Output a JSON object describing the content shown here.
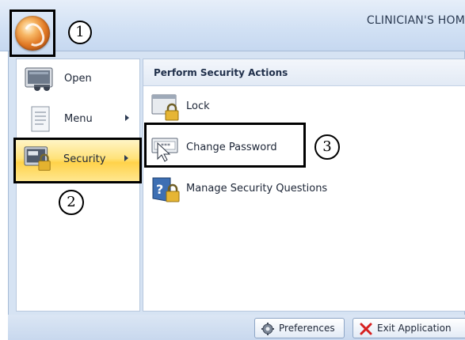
{
  "window": {
    "title": "CLINICIAN'S HOM"
  },
  "app_button": {
    "icon": "app-orb-icon"
  },
  "callouts": [
    "1",
    "2",
    "3"
  ],
  "left_menu": {
    "items": [
      {
        "label": "Open",
        "icon": "open-folder-icon",
        "has_submenu": false
      },
      {
        "label": "Menu",
        "icon": "document-icon",
        "has_submenu": true
      },
      {
        "label": "Security",
        "icon": "security-lock-icon",
        "has_submenu": true,
        "selected": true
      }
    ]
  },
  "right_panel": {
    "header": "Perform Security Actions",
    "actions": [
      {
        "label": "Lock",
        "icon": "lock-icon"
      },
      {
        "label": "Change Password",
        "icon": "change-password-icon"
      },
      {
        "label": "Manage Security Questions",
        "icon": "security-questions-icon"
      }
    ]
  },
  "footer": {
    "preferences_label": "Preferences",
    "exit_label": "Exit Application"
  },
  "colors": {
    "highlight": "#ffe27a",
    "frame": "#d6e3f3",
    "exit_icon": "#d62020"
  }
}
